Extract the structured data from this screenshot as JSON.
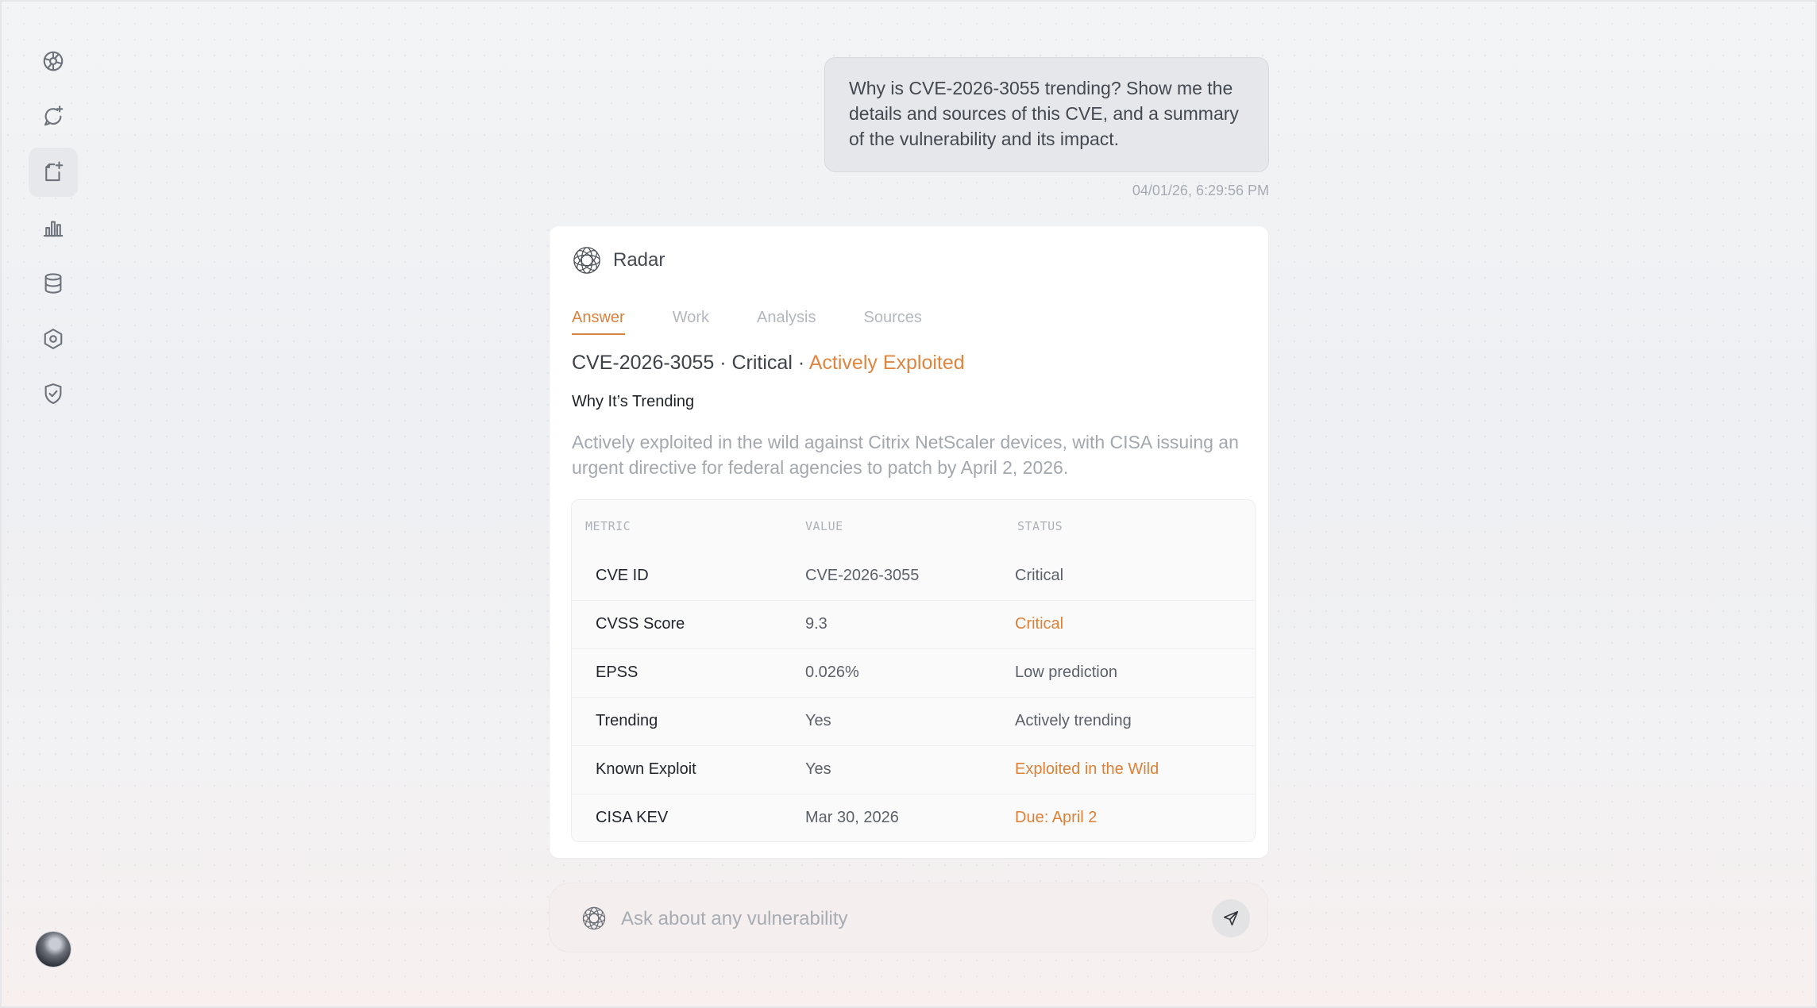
{
  "sidebar": {
    "items": [
      {
        "icon": "radar-icon"
      },
      {
        "icon": "chat-sparkle-icon"
      },
      {
        "icon": "document-sparkle-icon",
        "active": true
      },
      {
        "icon": "bar-chart-icon"
      },
      {
        "icon": "database-icon"
      },
      {
        "icon": "hex-settings-icon"
      },
      {
        "icon": "shield-check-icon"
      }
    ],
    "avatar": "user-avatar"
  },
  "conversation": {
    "user_message": "Why is CVE-2026-3055 trending? Show me the details and sources of this CVE, and a summary of the vulnerability and its impact.",
    "timestamp": "04/01/26, 6:29:56 PM"
  },
  "answer": {
    "assistant_name": "Radar",
    "tabs": [
      {
        "label": "Answer",
        "active": true
      },
      {
        "label": "Work"
      },
      {
        "label": "Analysis"
      },
      {
        "label": "Sources"
      }
    ],
    "heading_main": "CVE-2026-3055 · Critical · ",
    "heading_accent": "Actively Exploited",
    "section_title": "Why It’s Trending",
    "summary": "Actively exploited in the wild against Citrix NetScaler devices, with CISA issuing an urgent directive for federal agencies to patch by April 2, 2026.",
    "table": {
      "headers": [
        "METRIC",
        "VALUE",
        "STATUS"
      ],
      "rows": [
        {
          "metric": "CVE ID",
          "value": "CVE-2026-3055",
          "status": "Critical",
          "accent": false
        },
        {
          "metric": "CVSS Score",
          "value": "9.3",
          "status": "Critical",
          "accent": true
        },
        {
          "metric": "EPSS",
          "value": "0.026%",
          "status": "Low prediction",
          "accent": false
        },
        {
          "metric": "Trending",
          "value": "Yes",
          "status": "Actively trending",
          "accent": false
        },
        {
          "metric": "Known Exploit",
          "value": "Yes",
          "status": "Exploited in the Wild",
          "accent": true
        },
        {
          "metric": "CISA KEV",
          "value": "Mar 30, 2026",
          "status": "Due: April 2",
          "accent": true
        }
      ]
    }
  },
  "input": {
    "placeholder": "Ask about any vulnerability",
    "value": ""
  },
  "colors": {
    "accent": "#d9823f",
    "background": "#f1f2f4",
    "card": "#ffffff"
  }
}
